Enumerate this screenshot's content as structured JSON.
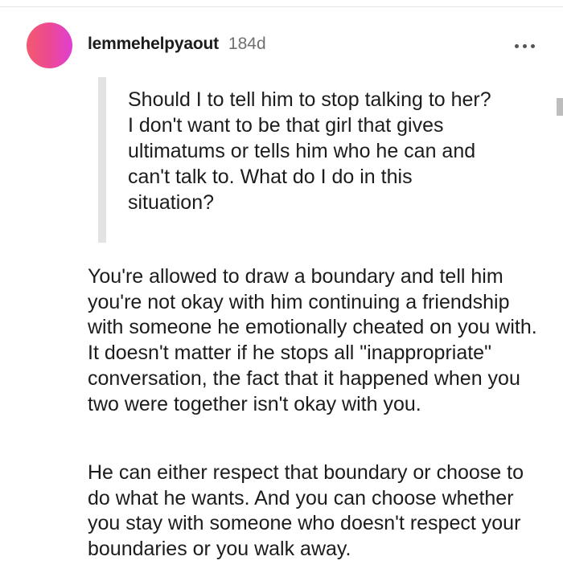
{
  "comment": {
    "username": "lemmehelpyaout",
    "age": "184d",
    "avatar_gradient": [
      "#f25a6e",
      "#ee4a8e",
      "#df3fd2"
    ],
    "more_icon": "more-horizontal-icon",
    "quote": "Should I to tell him to stop talking to her? I don't want to be that girl that gives ultimatums or tells him who he can and can't talk to. What do I do in this situation?",
    "paragraphs": [
      "You're allowed to draw a boundary and tell him you're not okay with him continuing a friendship with someone he emotionally cheated on you with. It doesn't matter if he stops all \"inappropriate\" conversation, the fact that it happened when you two were together isn't okay with you.",
      "He can either respect that boundary or choose to do what he wants. And you can choose whether you stay with someone who doesn't respect your boundaries or you walk away."
    ]
  }
}
